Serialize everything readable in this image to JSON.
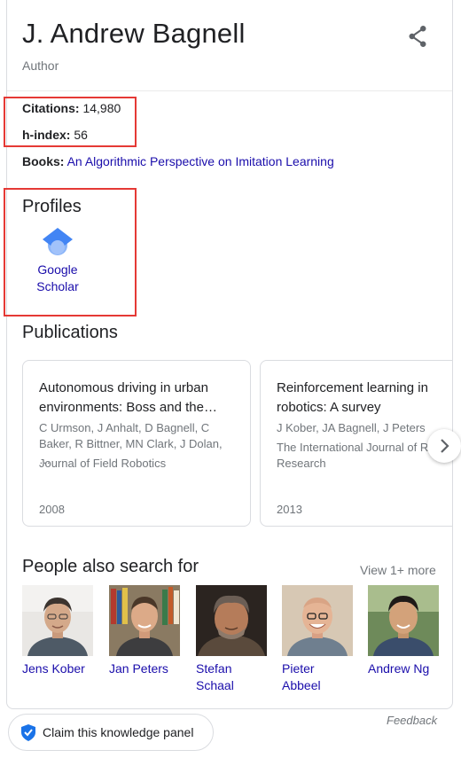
{
  "header": {
    "name": "J. Andrew Bagnell",
    "subtitle": "Author",
    "share_icon": "share-icon"
  },
  "facts": {
    "citations_label": "Citations:",
    "citations_value": "14,980",
    "hindex_label": "h-index:",
    "hindex_value": "56",
    "books_label": "Books:",
    "books_value": "An Algorithmic Perspective on Imitation Learning"
  },
  "profiles": {
    "title": "Profiles",
    "items": [
      {
        "label_line1": "Google",
        "label_line2": "Scholar",
        "icon": "google-scholar-icon"
      }
    ]
  },
  "publications": {
    "title": "Publications",
    "cards": [
      {
        "title": "Autonomous driving in urban environments: Boss and the…",
        "authors": "C Urmson, J Anhalt, D Bagnell, C Baker, R Bittner, MN Clark, J Dolan, …",
        "journal": "Journal of Field Robotics",
        "year": "2008"
      },
      {
        "title": "Reinforcement learning in robotics: A survey",
        "authors": "J Kober, JA Bagnell, J Peters",
        "journal": "The International Journal of Robotics Research",
        "year": "2013"
      }
    ],
    "next_icon": "chevron-right-icon"
  },
  "people": {
    "title": "People also search for",
    "view_more": "View 1+ more",
    "items": [
      {
        "line1": "Jens Kober",
        "line2": ""
      },
      {
        "line1": "Jan Peters",
        "line2": ""
      },
      {
        "line1": "Stefan",
        "line2": "Schaal"
      },
      {
        "line1": "Pieter",
        "line2": "Abbeel"
      },
      {
        "line1": "Andrew Ng",
        "line2": ""
      }
    ]
  },
  "footer": {
    "feedback": "Feedback",
    "claim": "Claim this knowledge panel",
    "claim_icon": "verified-shield-icon"
  },
  "colors": {
    "link": "#1a0dab",
    "highlight_box": "#e53935",
    "muted_text": "#70757a"
  }
}
